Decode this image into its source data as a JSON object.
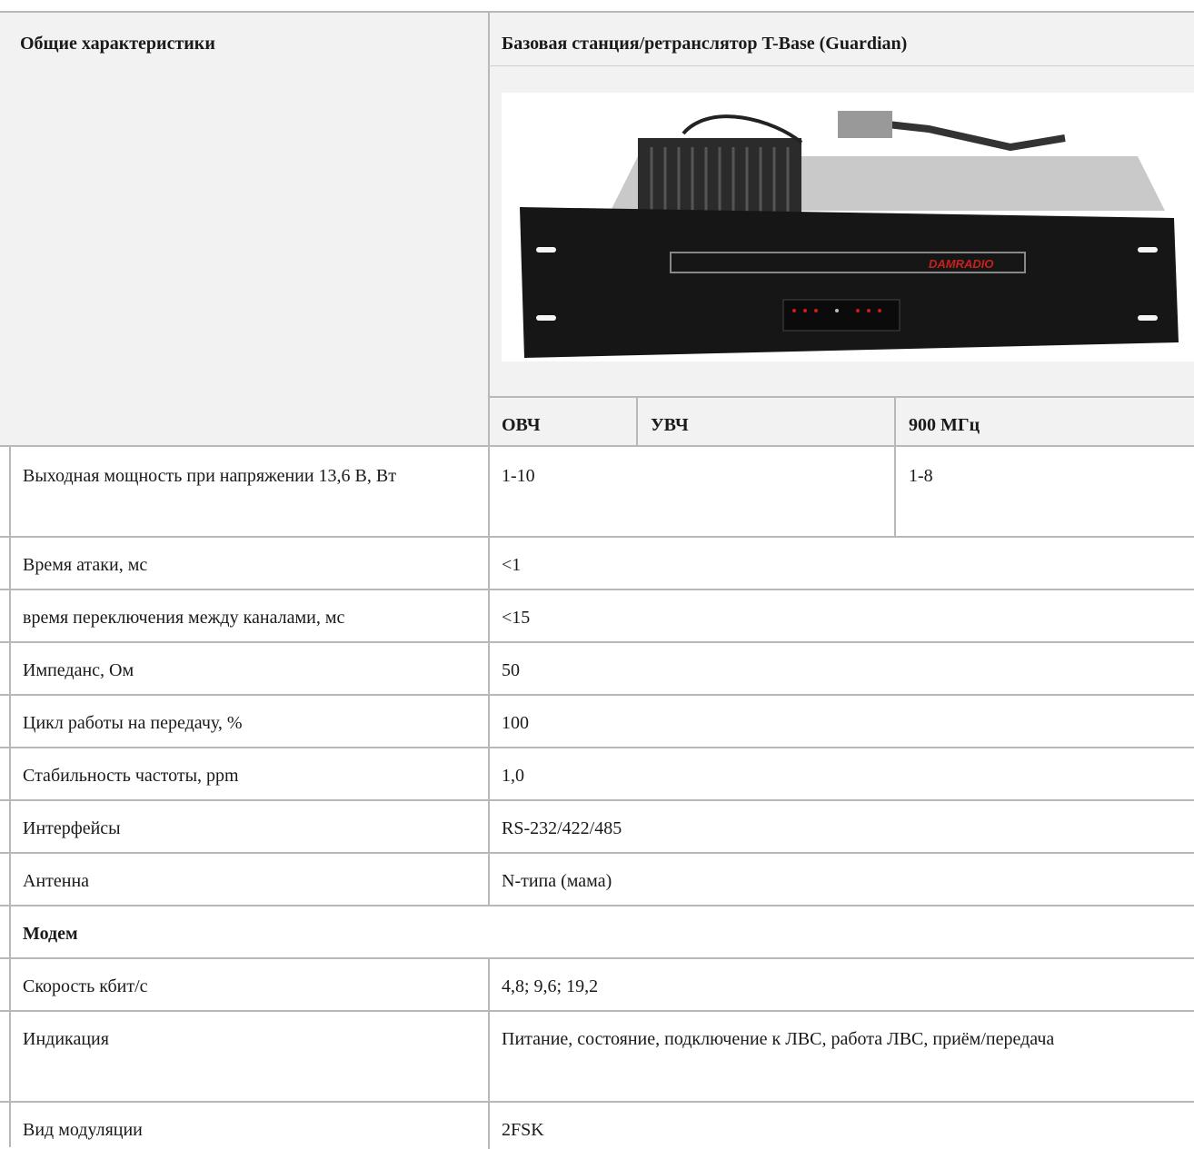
{
  "header": {
    "left_title": "Общие характеристики",
    "right_title": "Базовая станция/ретранслятор T-Base (Guardian)",
    "photo_brand": "DAMRADIO",
    "band_cols": [
      "ОВЧ",
      "УВЧ",
      "900 МГц"
    ]
  },
  "rows": [
    {
      "label": "Выходная мощность при напряжении 13,6 В, Вт",
      "value": "1-10",
      "value2": "1-8"
    },
    {
      "label": "Время атаки, мс",
      "value": "<1"
    },
    {
      "label": "время переключения между каналами, мс",
      "value": "<15"
    },
    {
      "label": "Импеданс, Ом",
      "value": "50"
    },
    {
      "label": "Цикл работы на передачу, %",
      "value": "100"
    },
    {
      "label": "Стабильность частоты, ppm",
      "value": "1,0"
    },
    {
      "label": "Интерфейсы",
      "value": "RS-232/422/485"
    },
    {
      "label": "Антенна",
      "value": "N-типа (мама)"
    }
  ],
  "section": {
    "title": "Модем"
  },
  "modem_rows": [
    {
      "label": "Скорость кбит/с",
      "value": "4,8; 9,6; 19,2"
    },
    {
      "label": "Индикация",
      "value": "Питание, состояние, подключение к ЛВС, работа ЛВС, приём/передача"
    },
    {
      "label": "Вид модуляции",
      "value": "2FSK"
    }
  ],
  "colors": {
    "border": "#b8b8b8",
    "header_bg": "#f2f2f2",
    "brand_red": "#c8201c"
  }
}
